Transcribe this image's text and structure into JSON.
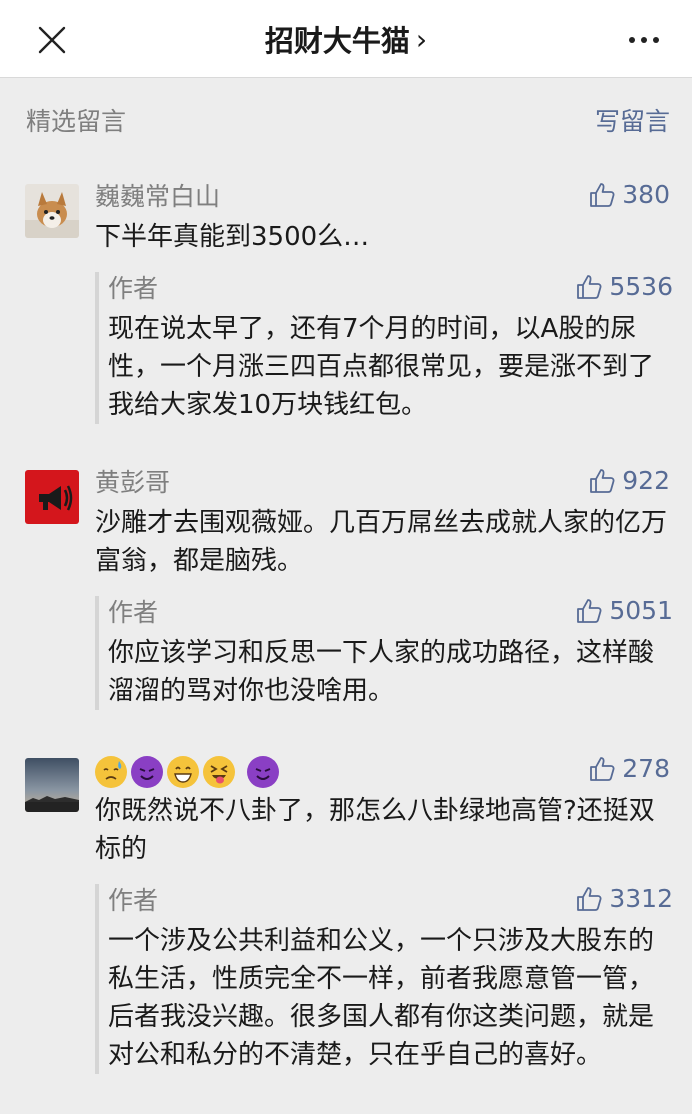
{
  "header": {
    "title": "招财大牛猫",
    "title_chevron": "›"
  },
  "section": {
    "title": "精选留言",
    "write_label": "写留言"
  },
  "comments": [
    {
      "nickname": "巍巍常白山",
      "likes": "380",
      "text": "下半年真能到3500么…",
      "reply": {
        "author": "作者",
        "likes": "5536",
        "text": "现在说太早了，还有7个月的时间，以A股的尿性，一个月涨三四百点都很常见，要是涨不到了我给大家发10万块钱红包。"
      }
    },
    {
      "nickname": "黄彭哥",
      "likes": "922",
      "text": "沙雕才去围观薇娅。几百万屌丝去成就人家的亿万富翁，都是脑残。",
      "reply": {
        "author": "作者",
        "likes": "5051",
        "text": "你应该学习和反思一下人家的成功路径，这样酸溜溜的骂对你也没啥用。"
      }
    },
    {
      "nickname_emojis": [
        "downcast-sweat-emoji",
        "smiling-devil-emoji",
        "grinning-emoji",
        "squinting-tongue-emoji",
        "smiling-devil-emoji"
      ],
      "likes": "278",
      "text": "你既然说不八卦了，那怎么八卦绿地高管?还挺双标的",
      "reply": {
        "author": "作者",
        "likes": "3312",
        "text": "一个涉及公共利益和公义，一个只涉及大股东的私生活，性质完全不一样，前者我愿意管一管，后者我没兴趣。很多国人都有你这类问题，就是对公和私分的不清楚，只在乎自己的喜好。"
      }
    }
  ],
  "colors": {
    "link": "#576b95",
    "muted": "#7f7f7f",
    "background": "#ededed"
  }
}
